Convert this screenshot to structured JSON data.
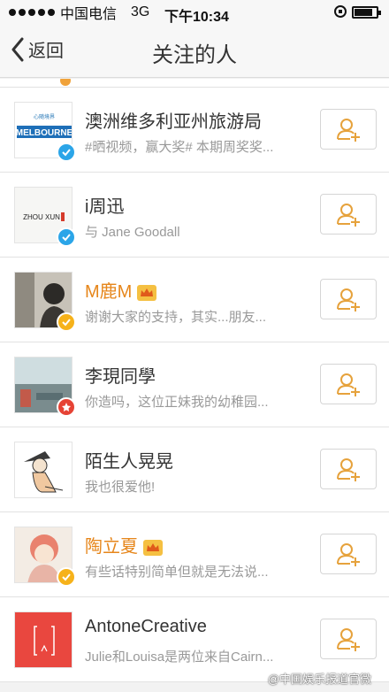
{
  "status_bar": {
    "carrier": "中国电信",
    "network": "3G",
    "time": "下午10:34"
  },
  "nav": {
    "back_label": "返回",
    "title": "关注的人"
  },
  "users": [
    {
      "name": "澳洲维多利亚州旅游局",
      "desc": "#晒视频，赢大奖# 本期周奖奖...",
      "avatar_text": "MELBOURNE",
      "avatar_subtext": "心随境界",
      "verified": "blue",
      "vip": false
    },
    {
      "name": "i周迅",
      "desc": "与 Jane Goodall",
      "avatar_text": "ZHOU XUN",
      "verified": "blue",
      "vip": false
    },
    {
      "name": "M鹿M",
      "desc": "谢谢大家的支持，其实...朋友...",
      "verified": "yellow",
      "vip": true
    },
    {
      "name": "李現同學",
      "desc": "你造吗，这位正妹我的幼稚园...",
      "verified": "red",
      "vip": false
    },
    {
      "name": "陌生人晃晃",
      "desc": "我也很爱他!",
      "verified": "none",
      "vip": false
    },
    {
      "name": "陶立夏",
      "desc": "有些话特别简单但就是无法说...",
      "verified": "yellow",
      "vip": true
    },
    {
      "name": "AntoneCreative",
      "desc": "Julie和Louisa是两位来自Cairn...",
      "verified": "none",
      "vip": false
    }
  ],
  "watermark": "@中国娱乐报道官微",
  "colors": {
    "accent": "#e6a23c",
    "vip_name": "#e6861b",
    "verified_blue": "#2ba5e8",
    "verified_yellow": "#f6b21a",
    "verified_red": "#e64335"
  }
}
